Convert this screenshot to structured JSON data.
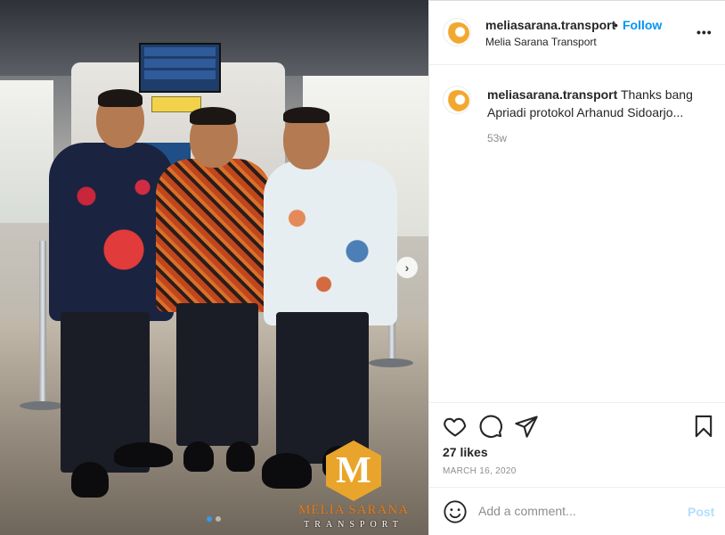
{
  "post": {
    "username": "meliasarana.transport",
    "separator": "•",
    "follow_label": "Follow",
    "display_name": "Melia Sarana Transport",
    "more_label": "•••"
  },
  "caption": {
    "username": "meliasarana.transport",
    "text": "Thanks bang Apriadi protokol Arhanud Sidoarjo...",
    "age": "53w"
  },
  "stats": {
    "likes": "27 likes",
    "date": "MARCH 16, 2020"
  },
  "comment": {
    "placeholder": "Add a comment...",
    "post_label": "Post"
  },
  "photo": {
    "watermark_logo": "M",
    "watermark_title": "MELIA SARANA",
    "watermark_sub": "TRANSPORT",
    "carousel_count": 2,
    "carousel_active": 1
  },
  "icons": {
    "like": "heart-icon",
    "comment": "comment-icon",
    "share": "send-icon",
    "save": "bookmark-icon",
    "emoji": "smiley-icon",
    "next": "chevron-right-icon"
  },
  "colors": {
    "link_blue": "#0095f6",
    "post_disabled": "#b2dffc",
    "muted": "#8e8e8e",
    "text": "#262626"
  }
}
